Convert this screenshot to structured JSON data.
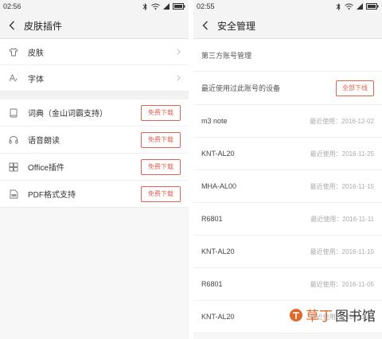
{
  "left": {
    "status": {
      "time": "02:56"
    },
    "nav": {
      "title": "皮肤插件"
    },
    "settings": [
      {
        "label": "皮肤",
        "icon": "tshirt-icon"
      },
      {
        "label": "字体",
        "icon": "font-icon"
      }
    ],
    "plugins": [
      {
        "label": "词典（金山词霸支持）",
        "icon": "book-icon",
        "button": "免费下载"
      },
      {
        "label": "语音朗读",
        "icon": "headphones-icon",
        "button": "免费下载"
      },
      {
        "label": "Office插件",
        "icon": "office-icon",
        "button": "免费下载"
      },
      {
        "label": "PDF格式支持",
        "icon": "pdf-icon",
        "button": "免费下载"
      }
    ]
  },
  "right": {
    "status": {
      "time": "02:55"
    },
    "nav": {
      "title": "安全管理"
    },
    "third_party": "第三方账号管理",
    "recent_header": "最近使用过此账号的设备",
    "logout_all": "全部下线",
    "devices": [
      {
        "name": "m3 note",
        "date": "最近使用：2016-12-02"
      },
      {
        "name": "KNT-AL20",
        "date": "最近使用：2016-11-25"
      },
      {
        "name": "MHA-AL00",
        "date": "最近使用：2016-11-15"
      },
      {
        "name": "R6801",
        "date": "最近使用：2016-11-11"
      },
      {
        "name": "KNT-AL20",
        "date": "最近使用：2016-11-10"
      },
      {
        "name": "R6801",
        "date": "最近使用：2016-11-05"
      },
      {
        "name": "KNT-AL20",
        "date": "最近使用：2016-11-03"
      }
    ],
    "watermark": {
      "part1": "草丁",
      "part2": "图书馆"
    }
  },
  "colors": {
    "accent": "#e0624f",
    "watermark_orange": "#e06a2c"
  }
}
